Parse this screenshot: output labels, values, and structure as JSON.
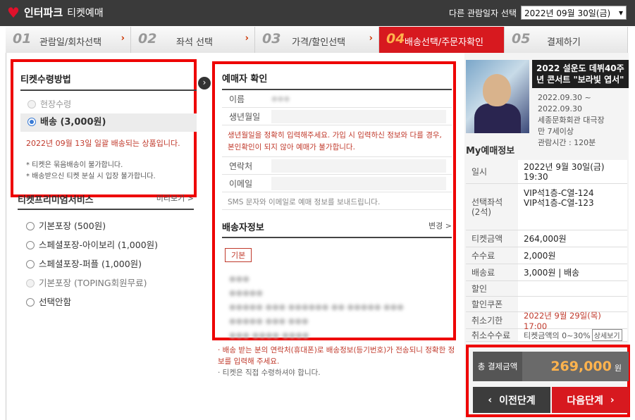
{
  "header": {
    "brand": "인터파크",
    "sub": "티켓예매",
    "date_label": "다른 관람일자 선택",
    "date_value": "2022년 09월 30일(금)"
  },
  "steps": [
    {
      "num": "01",
      "label": "관람일/회차선택"
    },
    {
      "num": "02",
      "label": "좌석 선택"
    },
    {
      "num": "03",
      "label": "가격/할인선택"
    },
    {
      "num": "04",
      "label": "배송선택/주문자확인"
    },
    {
      "num": "05",
      "label": "결제하기"
    }
  ],
  "receive": {
    "title": "티켓수령방법",
    "option_onsite": "현장수령",
    "option_delivery": "배송 (3,000원)",
    "delivery_date_msg": "2022년 09월 13일 일괄 배송되는 상품입니다.",
    "note1": "* 티켓은 묶음배송이 불가합니다.",
    "note2": "* 배송받으신 티켓 분실 시 입장 불가합니다."
  },
  "package": {
    "title": "티켓프리미엄서비스",
    "more": "미리보기 >",
    "items": [
      "기본포장 (500원)",
      "스페셜포장-아이보리 (1,000원)",
      "스페셜포장-퍼플 (1,000원)",
      "기본포장 (TOPING회원무료)",
      "선택안함"
    ]
  },
  "buyer": {
    "title": "예매자 확인",
    "name_label": "이름",
    "birth_label": "생년월일",
    "birth_warn": "생년월일을 정확히 입력해주세요. 가입 시 입력하신 정보와 다를 경우, 본인확인이 되지 않아 예매가 불가합니다.",
    "phone_label": "연락처",
    "email_label": "이메일",
    "sms_note": "SMS 문자와 이메일로 예매 정보를 보내드립니다."
  },
  "shipping": {
    "title": "배송자정보",
    "edit": "변경 >",
    "tag": "기본"
  },
  "mid_notes": {
    "n1": "· 배송 받는 분의 연락처(휴대폰)로 배송정보(등기번호)가 전송되니 정확한 정보를 입력해 주세요.",
    "n2": "· 티켓은 직접 수령하셔야 합니다."
  },
  "show": {
    "title": "2022 설운도 데뷔40주년 콘서트 \"보라빛 엽서\"",
    "period": "2022.09.30 ~ 2022.09.30",
    "venue": "세종문화회관 대극장",
    "age": "만 7세이상",
    "runtime": "관람시간 : 120분"
  },
  "my": {
    "title": "My예매정보",
    "date_k": "일시",
    "date_v": "2022년 9월 30일(금) 19:30",
    "seat_k": "선택좌석\n(2석)",
    "seat_v": "VIP석1층-C열-124\nVIP석1층-C열-123",
    "price_k": "티켓금액",
    "price_v": "264,000원",
    "fee_k": "수수료",
    "fee_v": "2,000원",
    "ship_k": "배송료",
    "ship_v": "3,000원 | 배송",
    "disc_k": "할인",
    "disc_v": "",
    "coupon_k": "할인쿠폰",
    "coupon_v": "",
    "cancel_k": "취소기한",
    "cancel_v": "2022년 9월 29일(목) 17:00",
    "cfee_k": "취소수수료",
    "cfee_v": "티켓금액의 0~30%",
    "cfee_btn": "상세보기"
  },
  "total": {
    "label": "총 결제금액",
    "amount": "269,000",
    "unit": "원"
  },
  "buttons": {
    "prev": "이전단계",
    "next": "다음단계"
  }
}
